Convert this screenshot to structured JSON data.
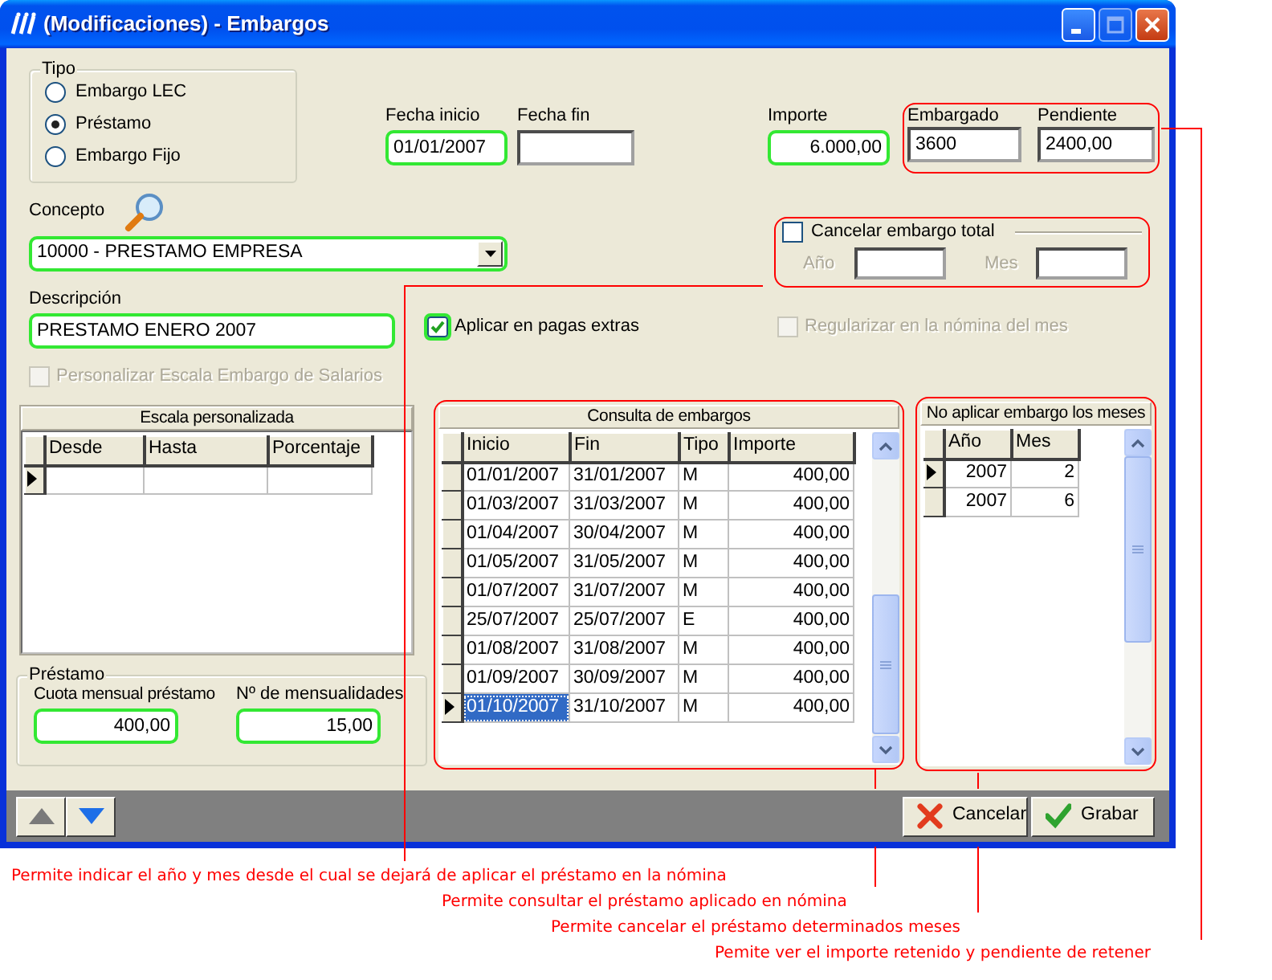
{
  "window": {
    "title": "(Modificaciones) - Embargos"
  },
  "tipo": {
    "legend": "Tipo",
    "options": [
      {
        "label": "Embargo LEC",
        "selected": false
      },
      {
        "label": "Préstamo",
        "selected": true
      },
      {
        "label": "Embargo Fijo",
        "selected": false
      }
    ]
  },
  "fecha_inicio": {
    "label": "Fecha inicio",
    "value": "01/01/2007",
    "highlighted": true
  },
  "fecha_fin": {
    "label": "Fecha fin",
    "highlighted": false
  },
  "importe": {
    "label": "Importe",
    "value": "6.000,00",
    "highlighted": true
  },
  "embargado": {
    "label": "Embargado",
    "value": "3600",
    "highlighted": false
  },
  "pendiente": {
    "label": "Pendiente",
    "value": "2400,00",
    "highlighted": false
  },
  "concepto": {
    "label": "Concepto",
    "value": "10000 - PRESTAMO EMPRESA",
    "highlighted": true
  },
  "cancelar_embargo": {
    "label": "Cancelar embargo total",
    "checked": false,
    "year": {
      "label": "Año",
      "disabled": true
    },
    "month": {
      "label": "Mes",
      "disabled": true
    }
  },
  "descripcion": {
    "label": "Descripción",
    "value": "PRESTAMO ENERO 2007",
    "highlighted": true
  },
  "aplicar_pagas_extras": {
    "label": "Aplicar en pagas extras",
    "checked": true,
    "disabled": false,
    "highlighted": true
  },
  "regularizar": {
    "label": "Regularizar en la nómina del mes",
    "checked": false,
    "disabled": true,
    "highlighted": false
  },
  "personalizar_escala": {
    "label": "Personalizar Escala Embargo de Salarios",
    "checked": false,
    "disabled": true,
    "highlighted": false
  },
  "escala_personalizada": {
    "title": "Escala personalizada",
    "columns": [
      "Desde",
      "Hasta",
      "Porcentaje"
    ]
  },
  "prestamo": {
    "legend": "Préstamo",
    "cuota": {
      "label": "Cuota mensual préstamo",
      "value": "400,00",
      "highlighted": true
    },
    "mensualidades": {
      "label": "Nº de mensualidades",
      "value": "15,00",
      "highlighted": true
    }
  },
  "consulta_embargos": {
    "title": "Consulta de embargos",
    "columns": [
      "Inicio",
      "Fin",
      "Tipo",
      "Importe"
    ],
    "rows": [
      {
        "cells": [
          "01/01/2007",
          "31/01/2007",
          "M",
          "400,00"
        ],
        "selected": false,
        "focused": false
      },
      {
        "cells": [
          "01/03/2007",
          "31/03/2007",
          "M",
          "400,00"
        ],
        "selected": false,
        "focused": false
      },
      {
        "cells": [
          "01/04/2007",
          "30/04/2007",
          "M",
          "400,00"
        ],
        "selected": false,
        "focused": false
      },
      {
        "cells": [
          "01/05/2007",
          "31/05/2007",
          "M",
          "400,00"
        ],
        "selected": false,
        "focused": false
      },
      {
        "cells": [
          "01/07/2007",
          "31/07/2007",
          "M",
          "400,00"
        ],
        "selected": false,
        "focused": false
      },
      {
        "cells": [
          "25/07/2007",
          "25/07/2007",
          "E",
          "400,00"
        ],
        "selected": false,
        "focused": false
      },
      {
        "cells": [
          "01/08/2007",
          "31/08/2007",
          "M",
          "400,00"
        ],
        "selected": false,
        "focused": false
      },
      {
        "cells": [
          "01/09/2007",
          "30/09/2007",
          "M",
          "400,00"
        ],
        "selected": false,
        "focused": false
      },
      {
        "cells": [
          "01/10/2007",
          "31/10/2007",
          "M",
          "400,00"
        ],
        "selected": true,
        "focused": true
      }
    ]
  },
  "no_aplicar": {
    "title": "No aplicar embargo los meses",
    "columns": [
      "Año",
      "Mes"
    ],
    "rows": [
      {
        "cells": [
          "2007",
          "2"
        ],
        "selected": true,
        "focused": false
      },
      {
        "cells": [
          "2007",
          "6"
        ],
        "selected": false,
        "focused": false
      }
    ]
  },
  "buttons": [
    {
      "label": "Cancelar",
      "kind": "cancel"
    },
    {
      "label": "Grabar",
      "kind": "save"
    }
  ],
  "annotations": [
    "Permite indicar el año y mes desde el cual se dejará de aplicar el  préstamo en la nómina",
    "Permite consultar el  préstamo aplicado en nómina",
    "Permite cancelar el préstamo determinados meses",
    "Pemite ver el importe retenido y pendiente de retener"
  ]
}
